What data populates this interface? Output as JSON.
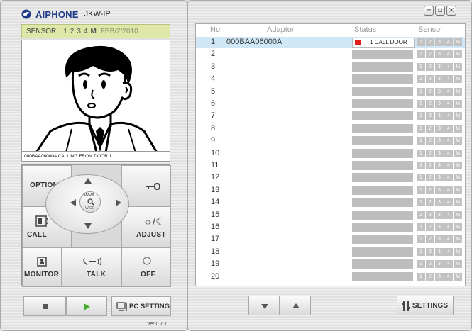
{
  "app": {
    "brand": "AIPHONE",
    "model": "JKW-IP",
    "version": "Ver 0.7.1"
  },
  "sensor_bar": {
    "label": "SENSOR",
    "nums": [
      "1",
      "2",
      "3",
      "4"
    ],
    "m": "M",
    "date": "FEB/2/2010"
  },
  "video_caption": "000BAA06000A CALLING FROM DOOR 1",
  "controls": {
    "option": "OPTION",
    "call": "CALL",
    "adjust": "ADJUST",
    "zoom": "ZOOM",
    "wide": "WIDE",
    "monitor": "MONITOR",
    "talk": "TALK",
    "off": "OFF"
  },
  "bottom_left": {
    "pc_setting": "PC SETTING"
  },
  "window_buttons": {
    "minimize": "−",
    "restore": "▫",
    "close": "×"
  },
  "list": {
    "headers": {
      "no": "No",
      "adaptor": "Adaptor",
      "status": "Status",
      "sensor": "Sensor"
    },
    "sensor_labels": [
      "1",
      "2",
      "3",
      "4",
      "M"
    ],
    "rows": [
      {
        "no": "1",
        "adaptor": "000BAA06000A",
        "status": "1 CALL DOOR",
        "selected": true
      },
      {
        "no": "2",
        "adaptor": "",
        "status": ""
      },
      {
        "no": "3",
        "adaptor": "",
        "status": ""
      },
      {
        "no": "4",
        "adaptor": "",
        "status": ""
      },
      {
        "no": "5",
        "adaptor": "",
        "status": ""
      },
      {
        "no": "6",
        "adaptor": "",
        "status": ""
      },
      {
        "no": "7",
        "adaptor": "",
        "status": ""
      },
      {
        "no": "8",
        "adaptor": "",
        "status": ""
      },
      {
        "no": "9",
        "adaptor": "",
        "status": ""
      },
      {
        "no": "10",
        "adaptor": "",
        "status": ""
      },
      {
        "no": "11",
        "adaptor": "",
        "status": ""
      },
      {
        "no": "12",
        "adaptor": "",
        "status": ""
      },
      {
        "no": "13",
        "adaptor": "",
        "status": ""
      },
      {
        "no": "14",
        "adaptor": "",
        "status": ""
      },
      {
        "no": "15",
        "adaptor": "",
        "status": ""
      },
      {
        "no": "16",
        "adaptor": "",
        "status": ""
      },
      {
        "no": "17",
        "adaptor": "",
        "status": ""
      },
      {
        "no": "18",
        "adaptor": "",
        "status": ""
      },
      {
        "no": "19",
        "adaptor": "",
        "status": ""
      },
      {
        "no": "20",
        "adaptor": "",
        "status": ""
      }
    ]
  },
  "bottom_right": {
    "settings": "SETTINGS"
  },
  "colors": {
    "sensor_bar_bg": "#dee6a8",
    "selected_row": "#cfe7f6",
    "status_red": "#e11f1f",
    "brand_blue": "#1f3a88"
  },
  "icons": [
    "aiphone-logo-icon",
    "stop-icon",
    "play-icon",
    "pc-setting-icon",
    "key-icon",
    "door-call-icon",
    "adjust-icon",
    "monitor-icon",
    "talk-icon",
    "power-icon",
    "zoom-icon",
    "arrow-up-icon",
    "arrow-down-icon",
    "arrow-left-icon",
    "arrow-right-icon",
    "settings-icon"
  ]
}
